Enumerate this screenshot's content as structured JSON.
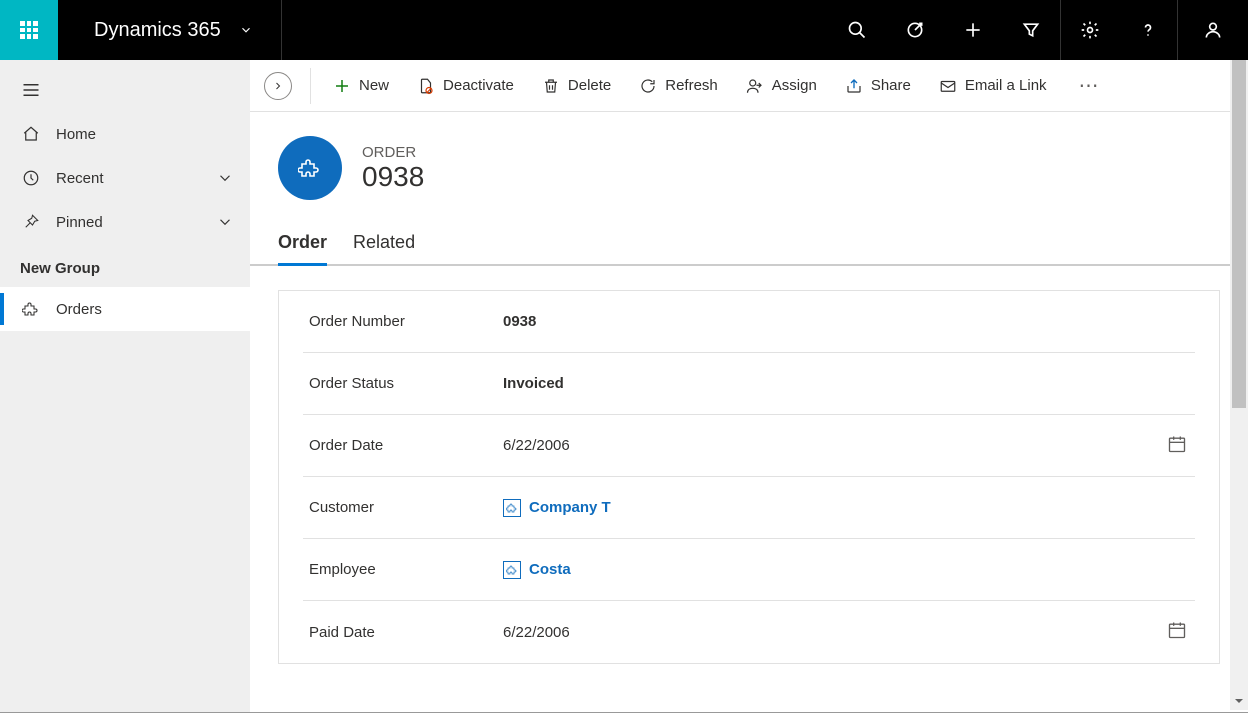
{
  "header": {
    "brand": "Dynamics 365"
  },
  "sidebar": {
    "home": "Home",
    "recent": "Recent",
    "pinned": "Pinned",
    "group_label": "New Group",
    "orders": "Orders"
  },
  "commands": {
    "new": "New",
    "deactivate": "Deactivate",
    "delete": "Delete",
    "refresh": "Refresh",
    "assign": "Assign",
    "share": "Share",
    "email_link": "Email a Link"
  },
  "record": {
    "entity": "ORDER",
    "name": "0938"
  },
  "tabs": {
    "order": "Order",
    "related": "Related"
  },
  "form": {
    "order_number": {
      "label": "Order Number",
      "value": "0938"
    },
    "order_status": {
      "label": "Order Status",
      "value": "Invoiced"
    },
    "order_date": {
      "label": "Order Date",
      "value": "6/22/2006"
    },
    "customer": {
      "label": "Customer",
      "value": "Company T"
    },
    "employee": {
      "label": "Employee",
      "value": "Costa"
    },
    "paid_date": {
      "label": "Paid Date",
      "value": "6/22/2006"
    }
  }
}
